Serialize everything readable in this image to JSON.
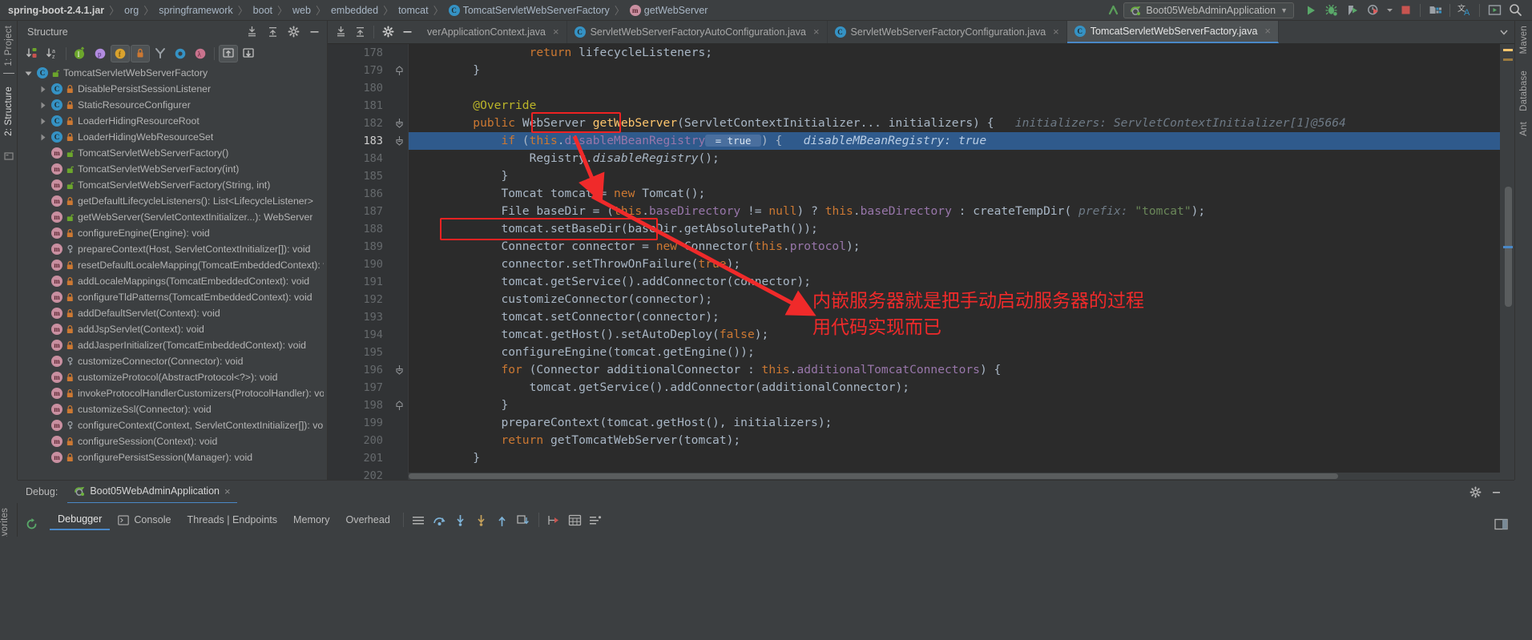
{
  "window": {
    "breadcrumb": [
      {
        "label": "spring-boot-2.4.1.jar",
        "icon": ""
      },
      {
        "label": "org",
        "icon": ""
      },
      {
        "label": "springframework",
        "icon": ""
      },
      {
        "label": "boot",
        "icon": ""
      },
      {
        "label": "web",
        "icon": ""
      },
      {
        "label": "embedded",
        "icon": ""
      },
      {
        "label": "tomcat",
        "icon": ""
      },
      {
        "label": "TomcatServletWebServerFactory",
        "icon": "class-icon"
      },
      {
        "label": "getWebServer",
        "icon": "method-icon"
      }
    ],
    "run_config": {
      "label": "Boot05WebAdminApplication",
      "icon": "spring-boot-icon",
      "chevron": "▼"
    },
    "toolbar_icons": [
      {
        "name": "hide-toolbar-icon",
        "glyph": "↖"
      },
      {
        "name": "run-icon",
        "glyph": "▶"
      },
      {
        "name": "debug-icon",
        "glyph": "bug"
      },
      {
        "name": "run-with-coverage-icon",
        "glyph": "coverage"
      },
      {
        "name": "profiler-icon",
        "glyph": "profiler"
      },
      {
        "name": "profiler-dropdown-icon",
        "glyph": "▾"
      },
      {
        "name": "stop-icon",
        "glyph": "■"
      },
      {
        "name": "project-structure-icon",
        "glyph": "structure"
      },
      {
        "name": "translate-icon",
        "glyph": "文A"
      },
      {
        "name": "presentation-icon",
        "glyph": "screen"
      },
      {
        "name": "search-everywhere-icon",
        "glyph": "🔍"
      }
    ]
  },
  "left_stripes": [
    {
      "label": "1: Project",
      "name": "tool-window-project",
      "active": false
    },
    {
      "label": "2: Structure",
      "name": "tool-window-structure",
      "active": true
    }
  ],
  "right_stripes": [
    {
      "label": "Maven",
      "name": "tool-window-maven"
    },
    {
      "label": "Database",
      "name": "tool-window-database"
    },
    {
      "label": "Ant",
      "name": "tool-window-ant"
    }
  ],
  "bottom_stripe": {
    "label": "Favorites",
    "name": "tool-window-favorites"
  },
  "structure": {
    "title": "Structure",
    "header_buttons": [
      {
        "name": "expand-all-icon"
      },
      {
        "name": "collapse-all-icon"
      },
      {
        "name": "settings-gear-icon"
      },
      {
        "name": "hide-icon"
      }
    ],
    "toolbar": [
      {
        "name": "sort-by-visibility-button",
        "active": false
      },
      {
        "name": "sort-alphabetically-button",
        "active": false
      },
      {
        "name": "show-inherited-button",
        "active": false
      },
      {
        "name": "show-properties-button",
        "active": false
      },
      {
        "name": "show-fields-button",
        "active": true
      },
      {
        "name": "show-non-public-button",
        "active": true
      },
      {
        "name": "show-anonymous-classes-button",
        "active": false
      },
      {
        "name": "show-lambdas-button",
        "active": false
      },
      {
        "name": "group-by-lambda-button",
        "active": false
      },
      {
        "name": "autoscroll-to-source-button",
        "active": true
      },
      {
        "name": "autoscroll-from-source-button",
        "active": false
      }
    ],
    "tree": [
      {
        "indent": 0,
        "arrow": "down",
        "icon": "class-icon",
        "access": "public",
        "label": "TomcatServletWebServerFactory"
      },
      {
        "indent": 1,
        "arrow": "right",
        "icon": "class-icon",
        "access": "protected",
        "label": "DisablePersistSessionListener"
      },
      {
        "indent": 1,
        "arrow": "right",
        "icon": "class-icon",
        "access": "protected",
        "label": "StaticResourceConfigurer"
      },
      {
        "indent": 1,
        "arrow": "right",
        "icon": "class-icon",
        "access": "protected",
        "label": "LoaderHidingResourceRoot"
      },
      {
        "indent": 1,
        "arrow": "right",
        "icon": "class-icon",
        "access": "protected",
        "label": "LoaderHidingWebResourceSet"
      },
      {
        "indent": 1,
        "arrow": "none",
        "icon": "method-icon",
        "access": "public",
        "label": "TomcatServletWebServerFactory()"
      },
      {
        "indent": 1,
        "arrow": "none",
        "icon": "method-icon",
        "access": "public",
        "label": "TomcatServletWebServerFactory(int)"
      },
      {
        "indent": 1,
        "arrow": "none",
        "icon": "method-icon",
        "access": "public",
        "label": "TomcatServletWebServerFactory(String, int)"
      },
      {
        "indent": 1,
        "arrow": "none",
        "icon": "method-icon",
        "access": "protected",
        "label": "getDefaultLifecycleListeners(): List<LifecycleListener>"
      },
      {
        "indent": 1,
        "arrow": "none",
        "icon": "method-icon",
        "access": "public",
        "label": "getWebServer(ServletContextInitializer...): WebServer"
      },
      {
        "indent": 1,
        "arrow": "none",
        "icon": "method-icon",
        "access": "protected",
        "label": "configureEngine(Engine): void"
      },
      {
        "indent": 1,
        "arrow": "none",
        "icon": "method-icon",
        "access": "private",
        "label": "prepareContext(Host, ServletContextInitializer[]): void"
      },
      {
        "indent": 1,
        "arrow": "none",
        "icon": "method-icon",
        "access": "protected",
        "label": "resetDefaultLocaleMapping(TomcatEmbeddedContext): void"
      },
      {
        "indent": 1,
        "arrow": "none",
        "icon": "method-icon",
        "access": "protected",
        "label": "addLocaleMappings(TomcatEmbeddedContext): void"
      },
      {
        "indent": 1,
        "arrow": "none",
        "icon": "method-icon",
        "access": "protected",
        "label": "configureTldPatterns(TomcatEmbeddedContext): void"
      },
      {
        "indent": 1,
        "arrow": "none",
        "icon": "method-icon",
        "access": "protected",
        "label": "addDefaultServlet(Context): void"
      },
      {
        "indent": 1,
        "arrow": "none",
        "icon": "method-icon",
        "access": "protected",
        "label": "addJspServlet(Context): void"
      },
      {
        "indent": 1,
        "arrow": "none",
        "icon": "method-icon",
        "access": "protected",
        "label": "addJasperInitializer(TomcatEmbeddedContext): void"
      },
      {
        "indent": 1,
        "arrow": "none",
        "icon": "method-icon",
        "access": "private",
        "label": "customizeConnector(Connector): void"
      },
      {
        "indent": 1,
        "arrow": "none",
        "icon": "method-icon",
        "access": "protected",
        "label": "customizeProtocol(AbstractProtocol<?>): void"
      },
      {
        "indent": 1,
        "arrow": "none",
        "icon": "method-icon",
        "access": "protected",
        "label": "invokeProtocolHandlerCustomizers(ProtocolHandler): void"
      },
      {
        "indent": 1,
        "arrow": "none",
        "icon": "method-icon",
        "access": "protected",
        "label": "customizeSsl(Connector): void"
      },
      {
        "indent": 1,
        "arrow": "none",
        "icon": "method-icon",
        "access": "private",
        "label": "configureContext(Context, ServletContextInitializer[]): void"
      },
      {
        "indent": 1,
        "arrow": "none",
        "icon": "method-icon",
        "access": "protected",
        "label": "configureSession(Context): void"
      },
      {
        "indent": 1,
        "arrow": "none",
        "icon": "method-icon",
        "access": "protected",
        "label": "configurePersistSession(Manager): void"
      }
    ]
  },
  "editor": {
    "tabs": [
      {
        "label": "verApplicationContext.java",
        "icon": "none",
        "active": false,
        "close": "×"
      },
      {
        "label": "ServletWebServerFactoryAutoConfiguration.java",
        "icon": "class-icon",
        "active": false,
        "close": "×"
      },
      {
        "label": "ServletWebServerFactoryConfiguration.java",
        "icon": "class-icon",
        "active": false,
        "close": "×"
      },
      {
        "label": "TomcatServletWebServerFactory.java",
        "icon": "class-icon",
        "active": true,
        "close": "×"
      }
    ],
    "tabbar_buttons": [
      {
        "name": "expand-all-icon"
      },
      {
        "name": "collapse-all-icon"
      },
      {
        "name": "settings-gear-icon"
      },
      {
        "name": "hide-icon"
      },
      {
        "name": "tab-list-chevron-icon"
      }
    ],
    "first_line": 178,
    "highlighted_line": 183,
    "lines": [
      {
        "n": 178,
        "indent": 4,
        "tokens": [
          {
            "t": "return ",
            "c": "kw"
          },
          {
            "t": "lifecycleListeners;",
            "c": "plain"
          }
        ]
      },
      {
        "n": 179,
        "indent": 2,
        "fold": "end",
        "tokens": [
          {
            "t": "}",
            "c": "plain"
          }
        ]
      },
      {
        "n": 180,
        "indent": 0,
        "tokens": []
      },
      {
        "n": 181,
        "indent": 2,
        "tokens": [
          {
            "t": "@Override",
            "c": "ann"
          }
        ]
      },
      {
        "n": 182,
        "indent": 2,
        "gutter_icon": "overriding-method-icon",
        "fold": "start",
        "tokens": [
          {
            "t": "public ",
            "c": "kw"
          },
          {
            "t": "WebServer ",
            "c": "plain"
          },
          {
            "t": "getWebServer",
            "c": "mth"
          },
          {
            "t": "(ServletContextInitializer... initializers) {",
            "c": "plain"
          },
          {
            "t": "   initializers: ServletContextInitializer[1]@5664",
            "c": "hint"
          }
        ]
      },
      {
        "n": 183,
        "indent": 3,
        "highlight": true,
        "fold": "start",
        "tokens": [
          {
            "t": "if ",
            "c": "kw"
          },
          {
            "t": "(",
            "c": "plain"
          },
          {
            "t": "this",
            "c": "kw"
          },
          {
            "t": ".",
            "c": "plain"
          },
          {
            "t": "disableMBeanRegistry",
            "c": "fld"
          },
          {
            "t": " = true ",
            "c": "hintbox"
          },
          {
            "t": ") {",
            "c": "plain"
          },
          {
            "t": "   disableMBeanRegistry: true",
            "c": "hint"
          }
        ]
      },
      {
        "n": 184,
        "indent": 4,
        "tokens": [
          {
            "t": "Registry.",
            "c": "plain"
          },
          {
            "t": "disableRegistry",
            "c": "ital-plain"
          },
          {
            "t": "();",
            "c": "plain"
          }
        ]
      },
      {
        "n": 185,
        "indent": 3,
        "tokens": [
          {
            "t": "}",
            "c": "plain"
          }
        ]
      },
      {
        "n": 186,
        "indent": 3,
        "tokens": [
          {
            "t": "Tomcat tomcat = ",
            "c": "plain"
          },
          {
            "t": "new ",
            "c": "kw"
          },
          {
            "t": "Tomcat();",
            "c": "plain"
          }
        ]
      },
      {
        "n": 187,
        "indent": 3,
        "tokens": [
          {
            "t": "File baseDir = (",
            "c": "plain"
          },
          {
            "t": "this",
            "c": "kw"
          },
          {
            "t": ".",
            "c": "plain"
          },
          {
            "t": "baseDirectory",
            "c": "fld"
          },
          {
            "t": " != ",
            "c": "plain"
          },
          {
            "t": "null",
            "c": "kw"
          },
          {
            "t": ") ? ",
            "c": "plain"
          },
          {
            "t": "this",
            "c": "kw"
          },
          {
            "t": ".",
            "c": "plain"
          },
          {
            "t": "baseDirectory",
            "c": "fld"
          },
          {
            "t": " : createTempDir(",
            "c": "plain"
          },
          {
            "t": " prefix: ",
            "c": "hint"
          },
          {
            "t": "\"tomcat\"",
            "c": "str"
          },
          {
            "t": ");",
            "c": "plain"
          }
        ]
      },
      {
        "n": 188,
        "indent": 3,
        "tokens": [
          {
            "t": "tomcat.setBaseDir(baseDir.getAbsolutePath());",
            "c": "plain"
          }
        ]
      },
      {
        "n": 189,
        "indent": 3,
        "tokens": [
          {
            "t": "Connector connector = ",
            "c": "plain"
          },
          {
            "t": "new ",
            "c": "kw"
          },
          {
            "t": "Connector(",
            "c": "plain"
          },
          {
            "t": "this",
            "c": "kw"
          },
          {
            "t": ".",
            "c": "plain"
          },
          {
            "t": "protocol",
            "c": "fld"
          },
          {
            "t": ");",
            "c": "plain"
          }
        ]
      },
      {
        "n": 190,
        "indent": 3,
        "tokens": [
          {
            "t": "connector.setThrowOnFailure(",
            "c": "plain"
          },
          {
            "t": "true",
            "c": "kw"
          },
          {
            "t": ");",
            "c": "plain"
          }
        ]
      },
      {
        "n": 191,
        "indent": 3,
        "tokens": [
          {
            "t": "tomcat.getService().addConnector(connector);",
            "c": "plain"
          }
        ]
      },
      {
        "n": 192,
        "indent": 3,
        "tokens": [
          {
            "t": "customizeConnector(connector);",
            "c": "plain"
          }
        ]
      },
      {
        "n": 193,
        "indent": 3,
        "tokens": [
          {
            "t": "tomcat.setConnector(connector);",
            "c": "plain"
          }
        ]
      },
      {
        "n": 194,
        "indent": 3,
        "tokens": [
          {
            "t": "tomcat.getHost().setAutoDeploy(",
            "c": "plain"
          },
          {
            "t": "false",
            "c": "kw"
          },
          {
            "t": ");",
            "c": "plain"
          }
        ]
      },
      {
        "n": 195,
        "indent": 3,
        "tokens": [
          {
            "t": "configureEngine(tomcat.getEngine());",
            "c": "plain"
          }
        ]
      },
      {
        "n": 196,
        "indent": 3,
        "fold": "start",
        "tokens": [
          {
            "t": "for ",
            "c": "kw"
          },
          {
            "t": "(Connector additionalConnector : ",
            "c": "plain"
          },
          {
            "t": "this",
            "c": "kw"
          },
          {
            "t": ".",
            "c": "plain"
          },
          {
            "t": "additionalTomcatConnectors",
            "c": "fld"
          },
          {
            "t": ") {",
            "c": "plain"
          }
        ]
      },
      {
        "n": 197,
        "indent": 4,
        "tokens": [
          {
            "t": "tomcat.getService().addConnector(additionalConnector);",
            "c": "plain"
          }
        ]
      },
      {
        "n": 198,
        "indent": 3,
        "fold": "end",
        "tokens": [
          {
            "t": "}",
            "c": "plain"
          }
        ]
      },
      {
        "n": 199,
        "indent": 3,
        "tokens": [
          {
            "t": "prepareContext(tomcat.getHost(), initializers);",
            "c": "plain"
          }
        ]
      },
      {
        "n": 200,
        "indent": 3,
        "tokens": [
          {
            "t": "return ",
            "c": "kw"
          },
          {
            "t": "getTomcatWebServer(tomcat);",
            "c": "plain"
          }
        ]
      },
      {
        "n": 201,
        "indent": 2,
        "tokens": [
          {
            "t": "}",
            "c": "plain"
          }
        ]
      },
      {
        "n": 202,
        "indent": 0,
        "tokens": []
      }
    ],
    "annotations": {
      "box_getwebserver": {
        "label": "getWebServer",
        "color": "#ee2222"
      },
      "box_new_tomcat": {
        "label": "Tomcat tomcat = new Tomcat();",
        "color": "#ee2222"
      },
      "note_line1": "内嵌服务器就是把手动启动服务器的过程",
      "note_line2": "用代码实现而已",
      "note_color": "#f02a2a"
    }
  },
  "debug": {
    "title": "Debug:",
    "session_tab": {
      "label": "Boot05WebAdminApplication",
      "icon": "spring-boot-icon",
      "close": "×"
    },
    "panel_buttons": [
      {
        "name": "settings-gear-icon"
      },
      {
        "name": "minimize-icon"
      }
    ],
    "rerun_icon": "rerun-icon",
    "tabs": [
      {
        "label": "Debugger",
        "name": "tab-debugger",
        "active": true,
        "icon": "none"
      },
      {
        "label": "Console",
        "name": "tab-console",
        "active": false,
        "icon": "console-icon"
      },
      {
        "label": "Threads | Endpoints",
        "name": "tab-threads-endpoints",
        "active": false,
        "icon": "none"
      },
      {
        "label": "Memory",
        "name": "tab-memory",
        "active": false,
        "icon": "none"
      },
      {
        "label": "Overhead",
        "name": "tab-overhead",
        "active": false,
        "icon": "none"
      }
    ],
    "step_buttons": [
      {
        "name": "show-execution-point-icon"
      },
      {
        "name": "step-over-icon"
      },
      {
        "name": "step-into-icon"
      },
      {
        "name": "force-step-into-icon"
      },
      {
        "name": "step-out-icon"
      },
      {
        "name": "drop-frame-icon"
      },
      {
        "name": "run-to-cursor-icon"
      },
      {
        "name": "evaluate-expression-icon"
      },
      {
        "name": "mute-breakpoints-icon"
      }
    ],
    "right_button": {
      "name": "layout-settings-icon"
    }
  },
  "colors": {
    "accent": "#4a88c7",
    "editor_bg": "#2b2b2b",
    "panel_bg": "#3c3f41",
    "gutter_bg": "#313335",
    "highlight_line": "#2f5a8c",
    "annotation_red": "#f02a2a",
    "keyword": "#cc7832",
    "string": "#6a8759",
    "field": "#9876aa",
    "method": "#ffc66d",
    "annotation_yellow": "#bbb529",
    "text": "#a9b7c6"
  }
}
